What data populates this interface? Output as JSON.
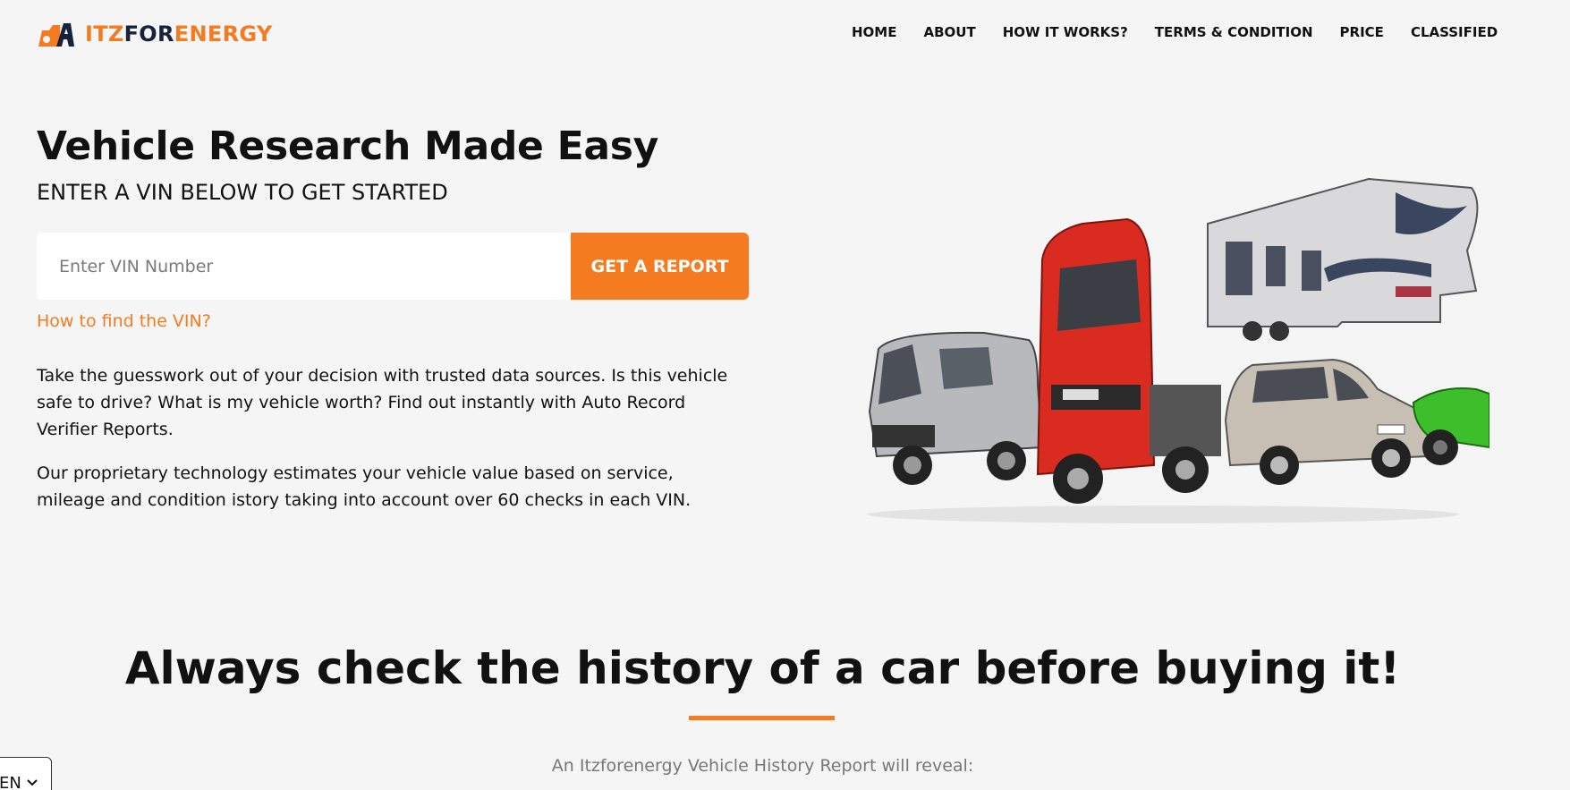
{
  "brand": {
    "name_part1": "ITZ",
    "name_part2": "FOR",
    "name_part3": "ENERGY",
    "accent_color": "#f47b20",
    "dark_color": "#17223b"
  },
  "nav": {
    "items": [
      {
        "label": "HOME"
      },
      {
        "label": "ABOUT"
      },
      {
        "label": "HOW IT WORKS?"
      },
      {
        "label": "TERMS & CONDITION"
      },
      {
        "label": "PRICE"
      },
      {
        "label": "CLASSIFIED"
      }
    ]
  },
  "hero": {
    "title": "Vehicle Research Made Easy",
    "subtitle": "ENTER A VIN BELOW TO GET STARTED",
    "vin_placeholder": "Enter VIN Number",
    "vin_value": "",
    "report_button": "GET A REPORT",
    "find_vin_link": "How to find the VIN?",
    "paragraph1": "Take the guesswork out of your decision with trusted data sources. Is this vehicle safe to drive? What is my vehicle worth? Find out instantly with Auto Record Verifier Reports.",
    "paragraph2": "Our proprietary technology estimates your vehicle value based on service, mileage and condition istory taking into account over 60 checks in each VIN.",
    "image_icon": "vehicles-illustration"
  },
  "section": {
    "title": "Always check the history of a car before buying it!",
    "subtitle": "An Itzforenergy Vehicle History Report will reveal:"
  },
  "language": {
    "selected": "EN"
  }
}
